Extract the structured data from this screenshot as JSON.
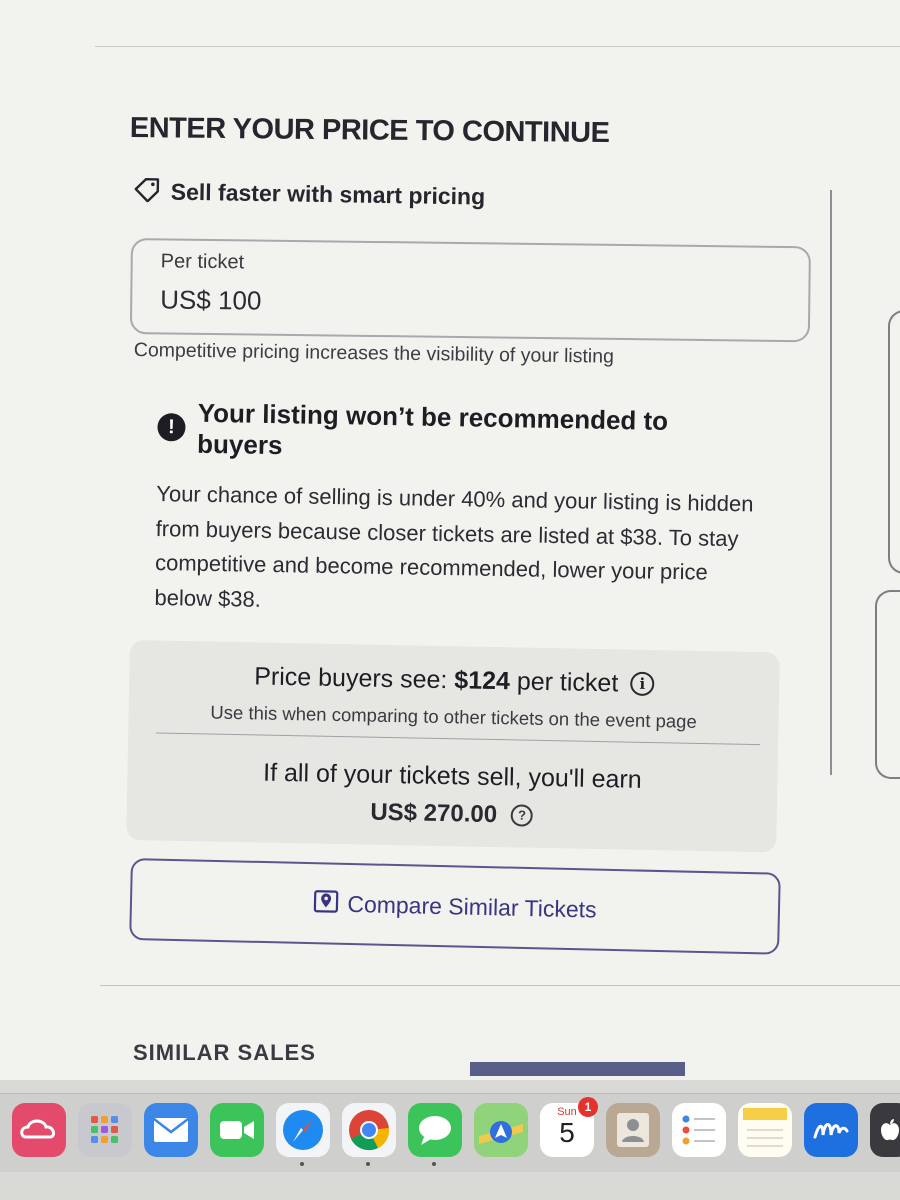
{
  "section": {
    "heading": "ENTER YOUR PRICE TO CONTINUE",
    "smart_pricing_label": "Sell faster with smart pricing"
  },
  "price_field": {
    "label": "Per ticket",
    "value": "US$ 100"
  },
  "hint": "Competitive pricing increases the visibility of your listing",
  "warning": {
    "icon": "!",
    "title": "Your listing won’t be recommended to buyers",
    "body": "Your chance of selling is under 40% and your listing is hidden from buyers because closer tickets are listed at $38. To stay competitive and become recommended, lower your price below $38."
  },
  "summary": {
    "buyer_price_prefix": "Price buyers see: ",
    "buyer_price_value": "$124",
    "buyer_price_suffix": " per ticket",
    "buyer_price_note": "Use this when comparing to other tickets on the event page",
    "earn_label": "If all of your tickets sell, you'll earn",
    "earn_value": "US$ 270.00",
    "info_icon": "i",
    "help_icon": "?"
  },
  "compare_button": {
    "label": "Compare Similar Tickets"
  },
  "next_section": {
    "heading_partial": "SIMILAR SALES"
  },
  "dock": {
    "calendar_day": "Sun",
    "calendar_date": "5",
    "calendar_badge": "1",
    "apps": [
      "creative-cloud-icon",
      "launchpad-icon",
      "mail-icon",
      "facetime-icon",
      "safari-icon",
      "chrome-icon",
      "messages-icon",
      "maps-icon",
      "calendar-icon",
      "contacts-icon",
      "reminders-icon",
      "notes-icon",
      "freeform-icon",
      "apple-icon"
    ]
  },
  "colors": {
    "accent_purple": "#3a3583",
    "text_dark": "#1e1d24",
    "warning_icon_bg": "#1e1d24"
  }
}
